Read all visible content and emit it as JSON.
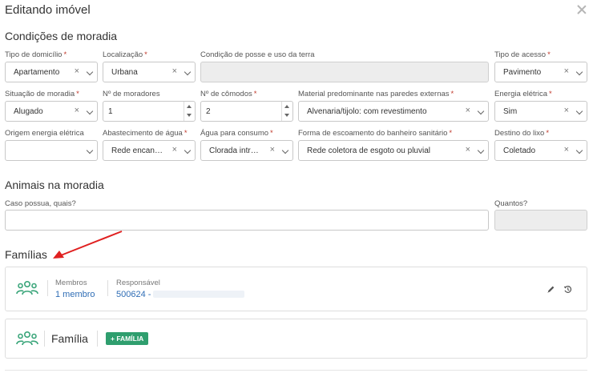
{
  "modal": {
    "title": "Editando imóvel",
    "close_icon": "close-icon"
  },
  "colors": {
    "required": "#c0392b",
    "link": "#2f6db5",
    "accent_green": "#2f9e6e",
    "annotation_arrow": "#e02020"
  },
  "conditions": {
    "title": "Condições de moradia",
    "tipo_domicilio": {
      "label": "Tipo de domicílio",
      "required": "*",
      "value": "Apartamento"
    },
    "localizacao": {
      "label": "Localização",
      "required": "*",
      "value": "Urbana"
    },
    "condicao_posse": {
      "label": "Condição de posse e uso da terra",
      "value": ""
    },
    "tipo_acesso": {
      "label": "Tipo de acesso",
      "required": "*",
      "value": "Pavimento"
    },
    "situacao_moradia": {
      "label": "Situação de moradia",
      "required": "*",
      "value": "Alugado"
    },
    "n_moradores": {
      "label": "Nº de moradores",
      "value": "1"
    },
    "n_comodos": {
      "label": "Nº de cômodos",
      "required": "*",
      "value": "2"
    },
    "material_paredes": {
      "label": "Material predominante nas paredes externas",
      "required": "*",
      "value": "Alvenaria/tijolo: com revestimento"
    },
    "energia_eletrica": {
      "label": "Energia elétrica",
      "required": "*",
      "value": "Sim"
    },
    "origem_energia": {
      "label": "Origem energia elétrica",
      "value": ""
    },
    "abastecimento_agua": {
      "label": "Abastecimento de água",
      "required": "*",
      "value": "Rede encanad..."
    },
    "agua_consumo": {
      "label": "Água para consumo",
      "required": "*",
      "value": "Clorada intrad..."
    },
    "escoamento_banheiro": {
      "label": "Forma de escoamento do banheiro sanitário",
      "required": "*",
      "value": "Rede coletora de esgoto ou pluvial"
    },
    "destino_lixo": {
      "label": "Destino do lixo",
      "required": "*",
      "value": "Coletado"
    }
  },
  "clear_glyph": "×",
  "animals": {
    "title": "Animais na moradia",
    "caso_possua": {
      "label": "Caso possua, quais?",
      "value": ""
    },
    "quantos": {
      "label": "Quantos?",
      "value": ""
    }
  },
  "families": {
    "title": "Famílias",
    "card": {
      "icon": "people-group-icon",
      "membros_label": "Membros",
      "membros_value": "1 membro",
      "responsavel_label": "Responsável",
      "responsavel_value": "500624 -",
      "edit_icon": "pencil-icon",
      "history_icon": "history-icon"
    },
    "add_card": {
      "icon": "people-group-icon",
      "label": "Família",
      "button_label": "+ FAMÍLIA"
    }
  }
}
